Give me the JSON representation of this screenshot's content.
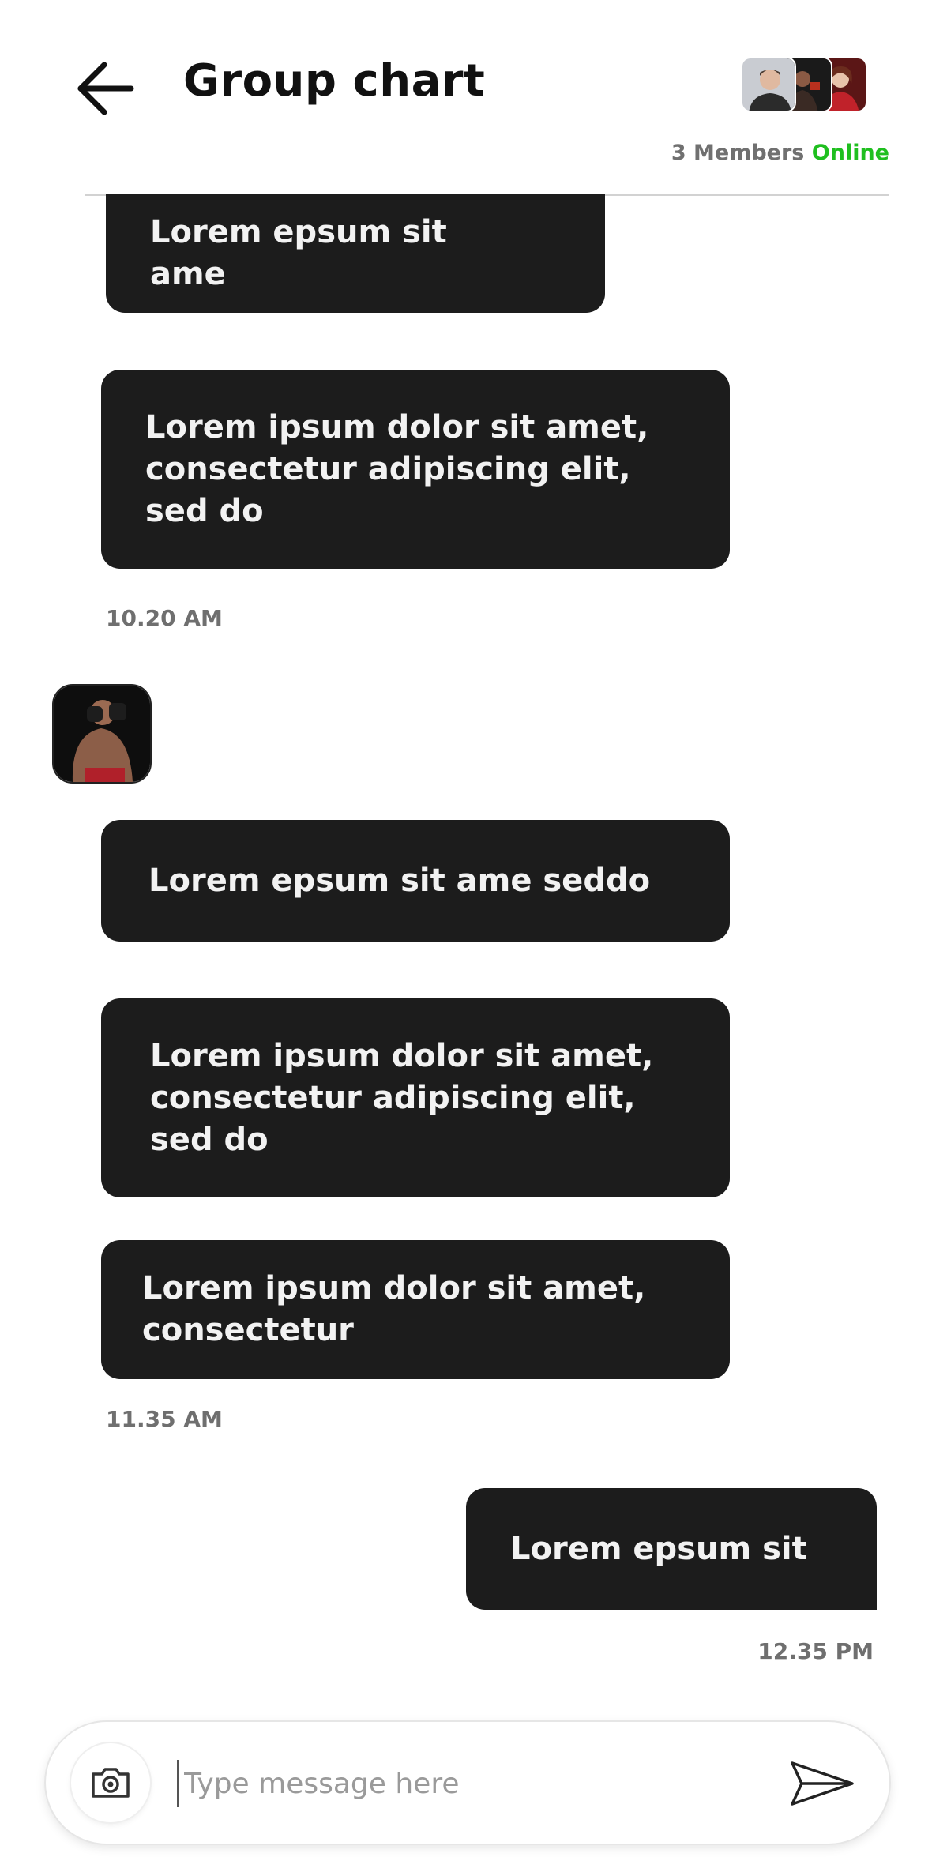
{
  "header": {
    "title": "Group chart",
    "members_count": "3 Members",
    "online_label": "Online",
    "back_icon": "arrow-left-icon"
  },
  "colors": {
    "bubble_bg": "#1c1c1c",
    "bubble_text": "#f2f2f2",
    "online": "#1fbf1f",
    "timestamp": "#6f6f6f"
  },
  "messages": [
    {
      "text": "Lorem epsum sit ame"
    },
    {
      "text": "Lorem ipsum dolor sit amet, consectetur adipiscing elit, sed do"
    },
    {
      "time": "10.20 AM"
    },
    {
      "text": "Lorem epsum sit ame seddo"
    },
    {
      "text": "Lorem ipsum dolor sit amet, consectetur adipiscing elit, sed do"
    },
    {
      "text": "Lorem ipsum dolor sit amet, consectetur"
    },
    {
      "time": "11.35 AM"
    },
    {
      "text": "Lorem epsum sit"
    },
    {
      "time": "12.35 PM"
    }
  ],
  "composer": {
    "placeholder": "Type message here",
    "camera_icon": "camera-icon",
    "send_icon": "send-icon"
  }
}
